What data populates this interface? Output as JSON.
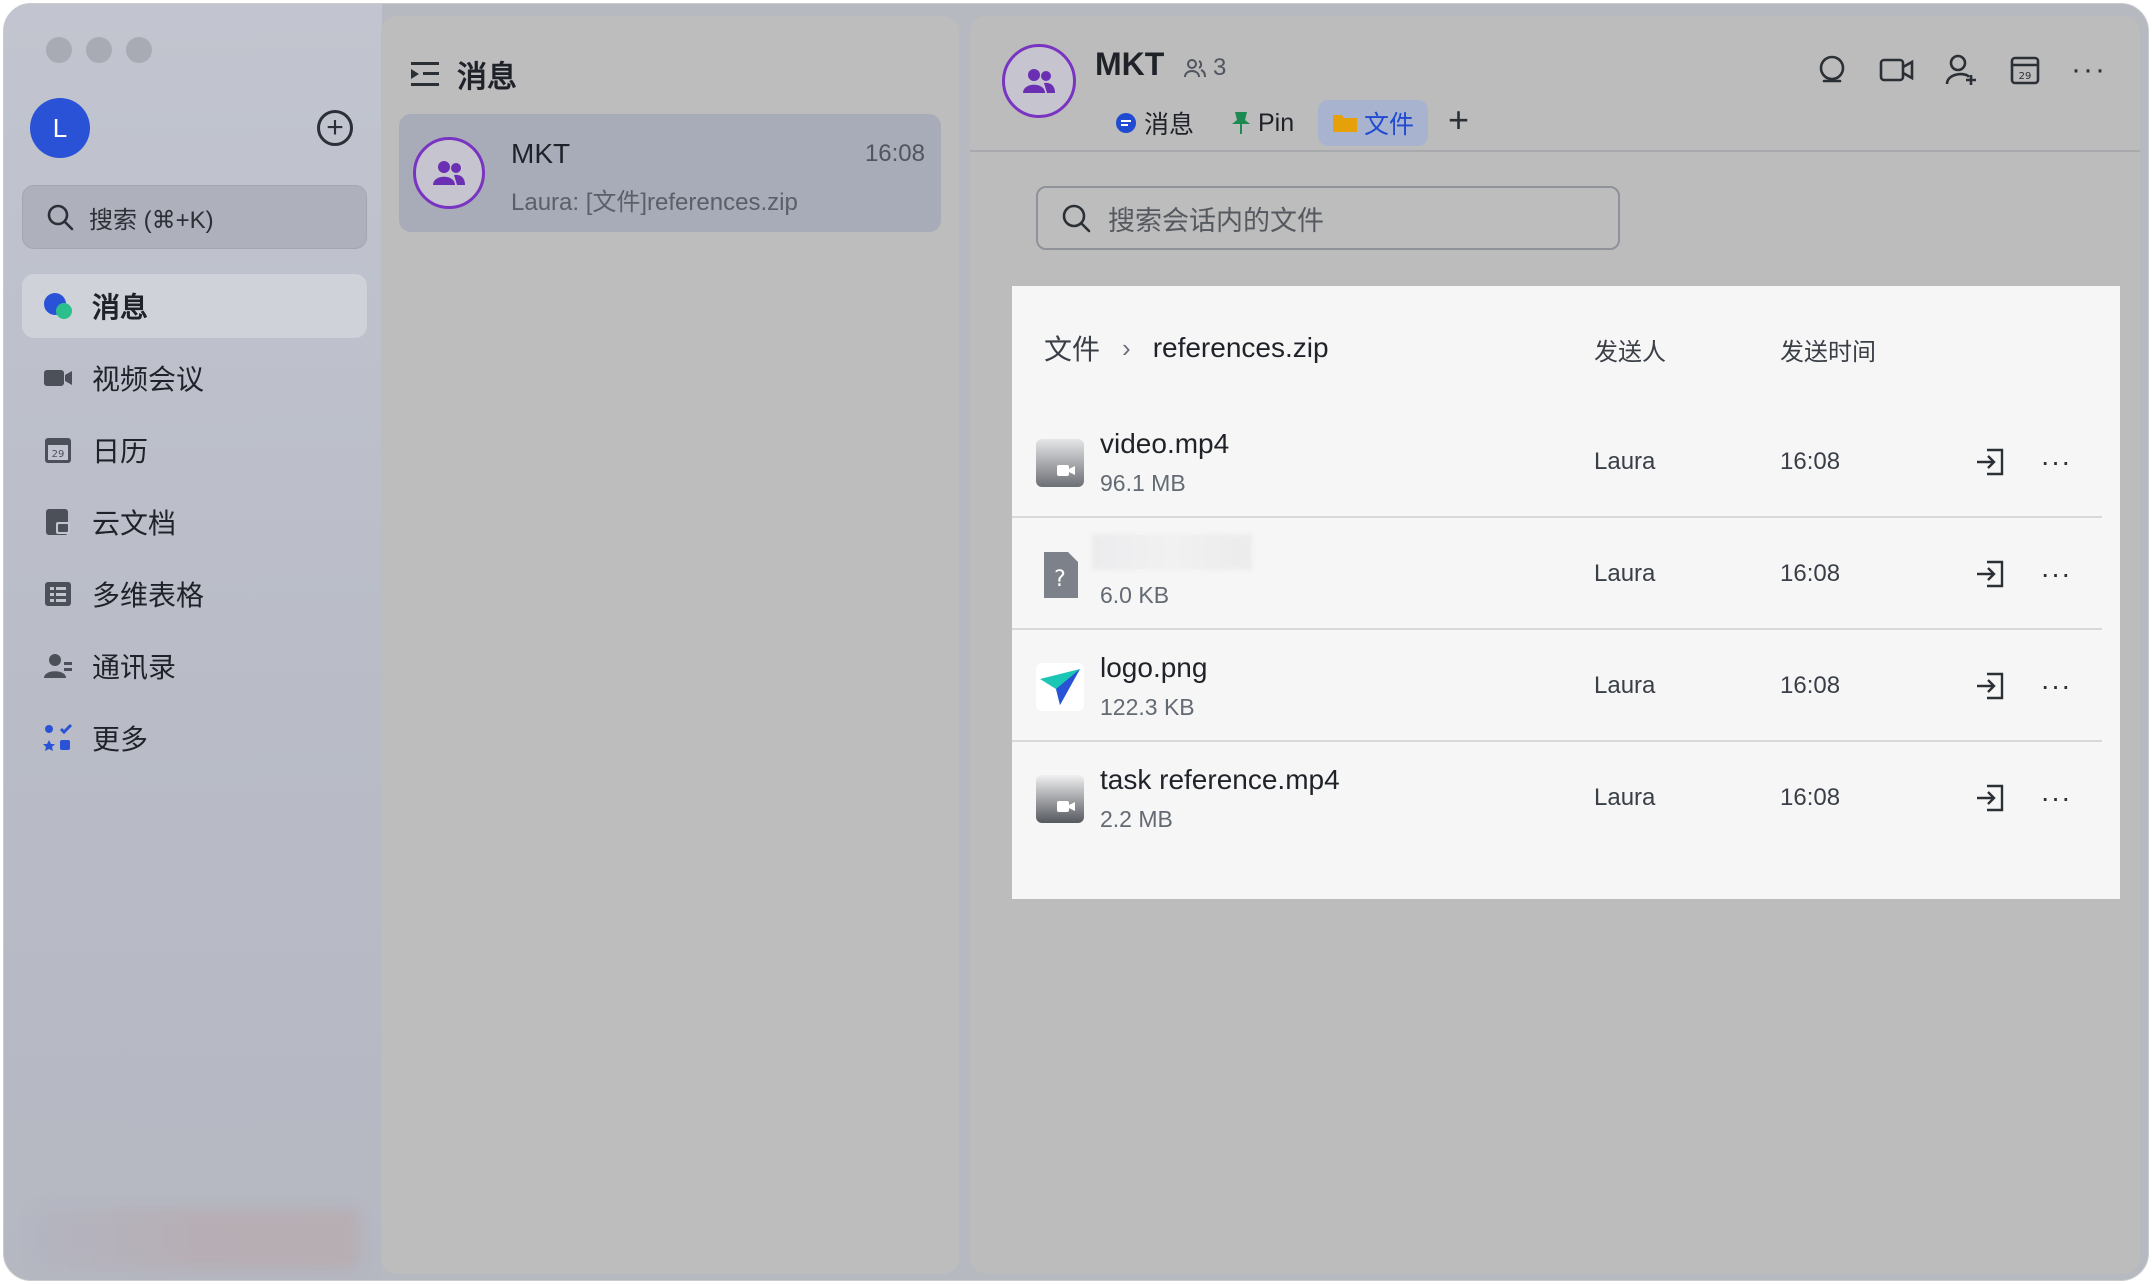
{
  "nav": {
    "avatar_letter": "L",
    "search_placeholder": "搜索 (⌘+K)",
    "items": [
      {
        "label": "消息",
        "icon": "chat-bubble-icon",
        "active": true
      },
      {
        "label": "视频会议",
        "icon": "video-camera-icon",
        "active": false
      },
      {
        "label": "日历",
        "icon": "calendar-icon",
        "active": false
      },
      {
        "label": "云文档",
        "icon": "cloud-doc-icon",
        "active": false
      },
      {
        "label": "多维表格",
        "icon": "table-icon",
        "active": false
      },
      {
        "label": "通讯录",
        "icon": "contacts-icon",
        "active": false
      },
      {
        "label": "更多",
        "icon": "apps-grid-icon",
        "active": false
      }
    ]
  },
  "chat_list": {
    "title": "消息",
    "items": [
      {
        "name": "MKT",
        "time": "16:08",
        "preview": "Laura: [文件]references.zip"
      }
    ]
  },
  "chat": {
    "group_name": "MKT",
    "member_count": "3",
    "tabs": [
      {
        "label": "消息",
        "icon": "chat-bubble-icon",
        "active": false
      },
      {
        "label": "Pin",
        "icon": "pin-icon",
        "active": false
      },
      {
        "label": "文件",
        "icon": "folder-icon",
        "active": true
      }
    ],
    "tab_add": "+",
    "header_actions": [
      "search-icon",
      "video-call-icon",
      "add-member-icon",
      "calendar-icon",
      "more-icon"
    ],
    "file_search_placeholder": "搜索会话内的文件",
    "breadcrumb": {
      "root": "文件",
      "current": "references.zip"
    },
    "columns": {
      "sender": "发送人",
      "time": "发送时间"
    },
    "files": [
      {
        "name": "video.mp4",
        "size": "96.1 MB",
        "sender": "Laura",
        "time": "16:08",
        "type": "video"
      },
      {
        "name": "",
        "size": "6.0 KB",
        "sender": "Laura",
        "time": "16:08",
        "type": "unknown"
      },
      {
        "name": "logo.png",
        "size": "122.3 KB",
        "sender": "Laura",
        "time": "16:08",
        "type": "image"
      },
      {
        "name": "task reference.mp4",
        "size": "2.2 MB",
        "sender": "Laura",
        "time": "16:08",
        "type": "video"
      }
    ],
    "more_glyph": "···"
  },
  "colors": {
    "accent": "#1f4ad1",
    "avatar": "#2a52d6",
    "group_ring": "#7a34c2"
  }
}
